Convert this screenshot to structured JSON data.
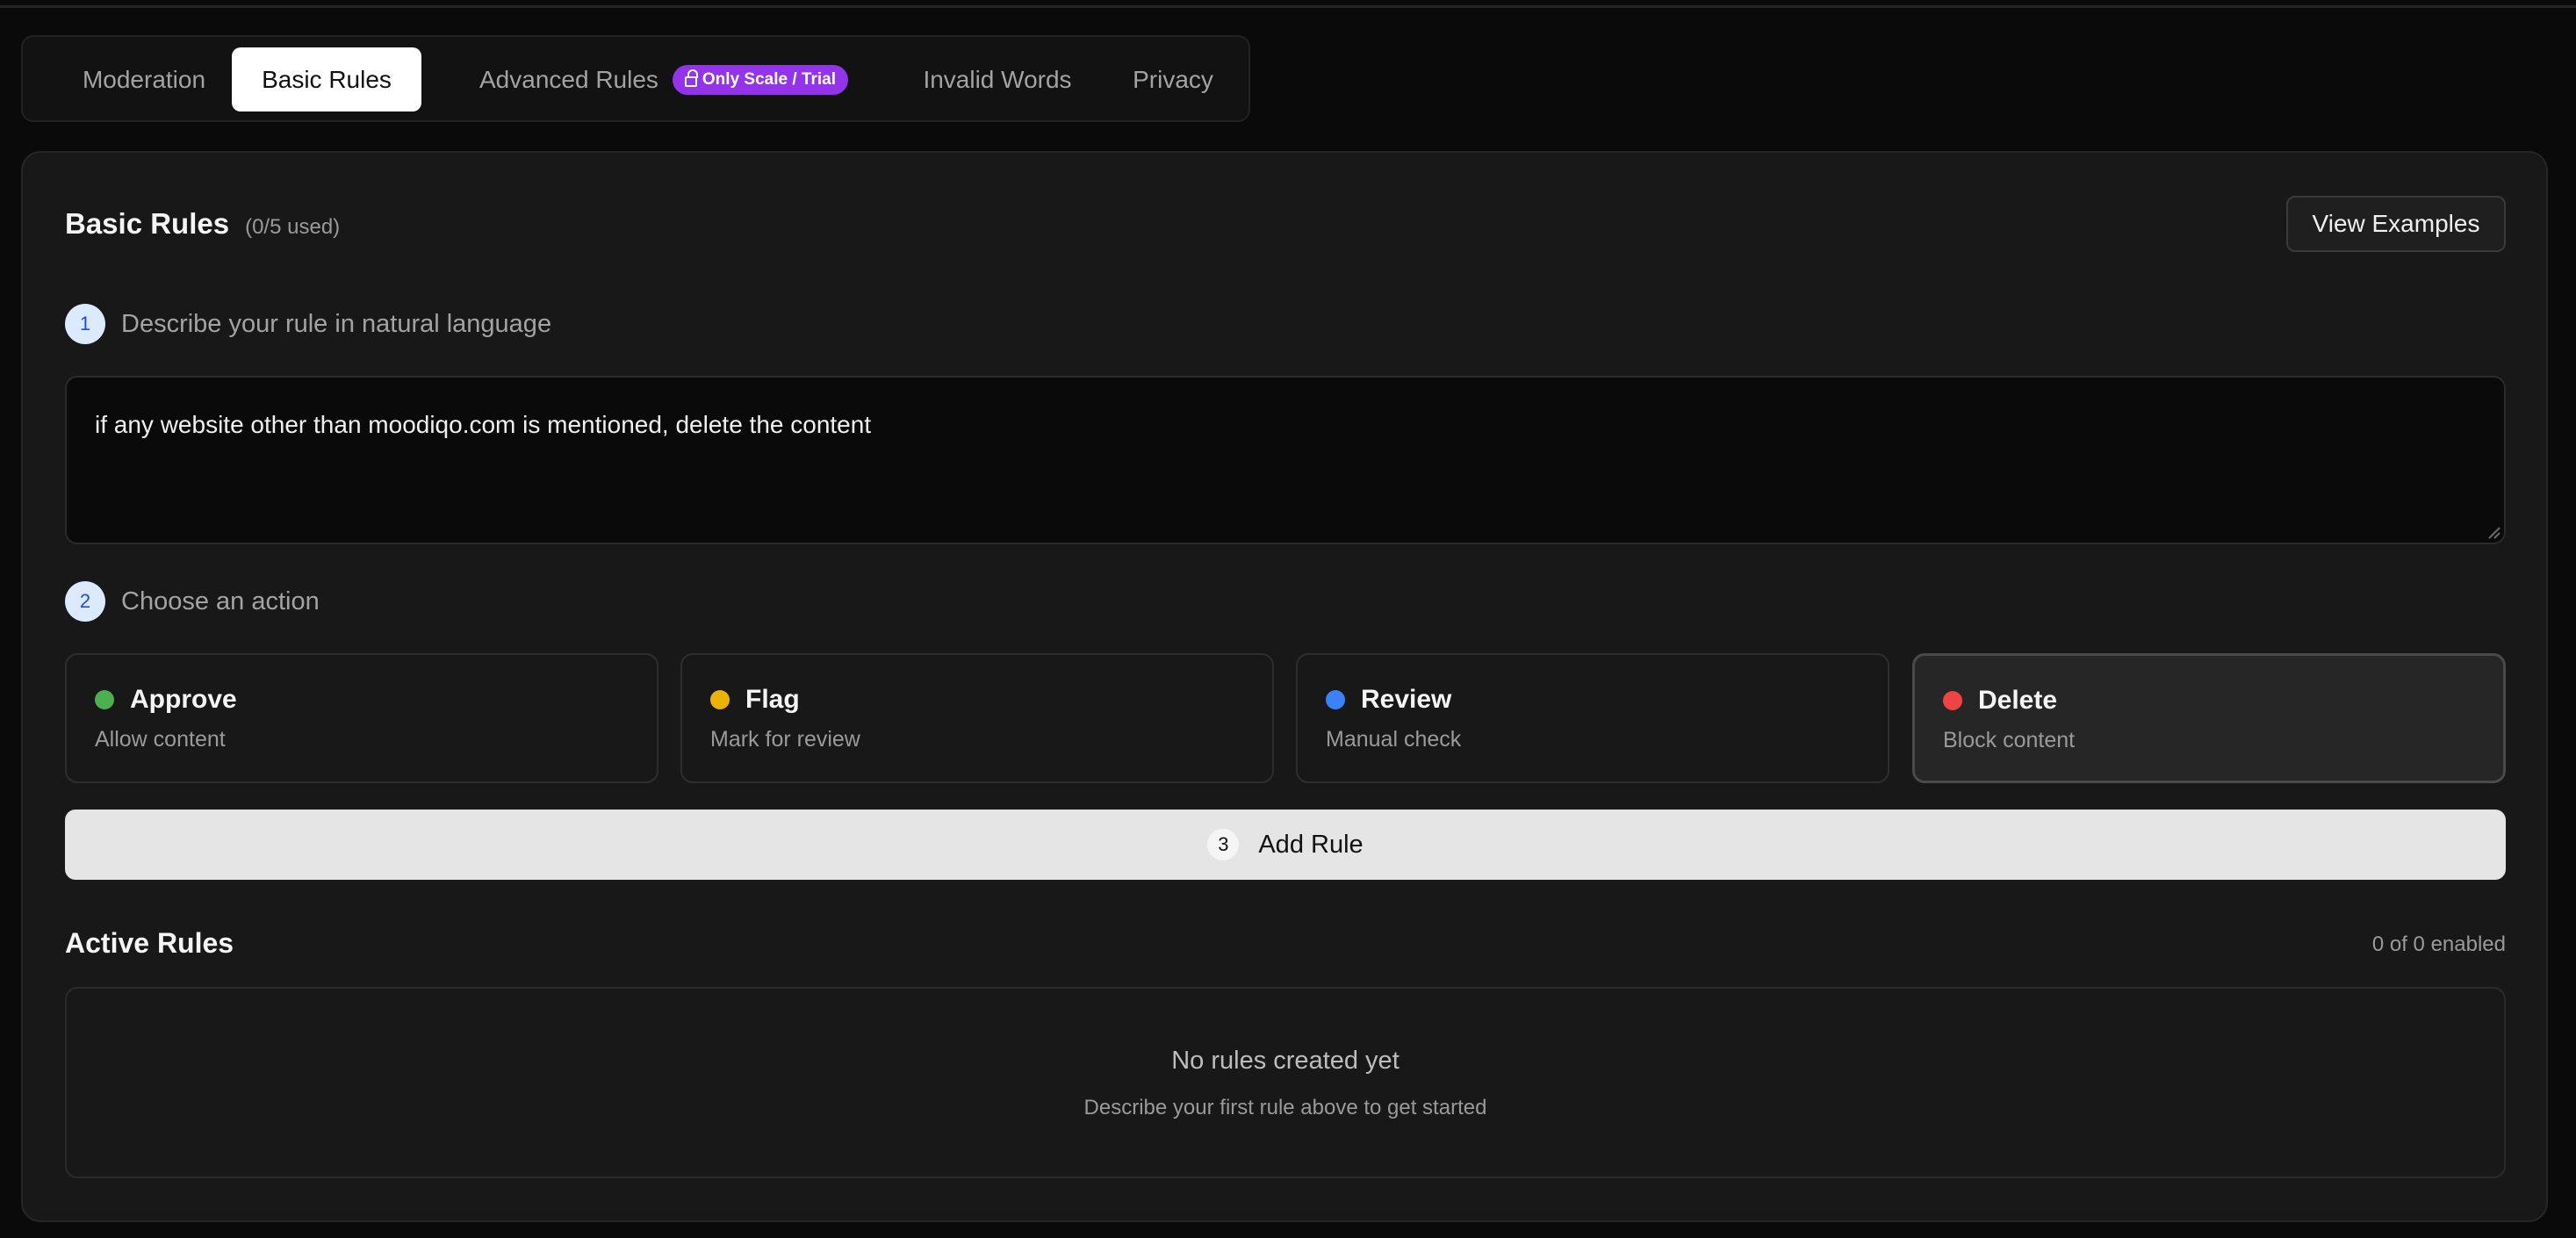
{
  "tabs": [
    {
      "label": "Moderation"
    },
    {
      "label": "Basic Rules"
    },
    {
      "label": "Advanced Rules",
      "badge": "Only Scale / Trial"
    },
    {
      "label": "Invalid Words"
    },
    {
      "label": "Privacy"
    }
  ],
  "active_tab": "Basic Rules",
  "panel": {
    "title": "Basic Rules",
    "used": "(0/5 used)",
    "view_examples": "View Examples"
  },
  "step1": {
    "num": "1",
    "label": "Describe your rule in natural language"
  },
  "rule_input": {
    "value": "if any website other than moodiqo.com is mentioned, delete the content"
  },
  "step2": {
    "num": "2",
    "label": "Choose an action"
  },
  "actions": [
    {
      "name": "Approve",
      "desc": "Allow content",
      "color": "#4caf50"
    },
    {
      "name": "Flag",
      "desc": "Mark for review",
      "color": "#eab308"
    },
    {
      "name": "Review",
      "desc": "Manual check",
      "color": "#3b82f6"
    },
    {
      "name": "Delete",
      "desc": "Block content",
      "color": "#ef4444"
    }
  ],
  "selected_action": "Delete",
  "add_rule": {
    "num": "3",
    "label": "Add Rule"
  },
  "active_rules": {
    "title": "Active Rules",
    "enabled": "0 of 0 enabled",
    "empty_title": "No rules created yet",
    "empty_subtitle": "Describe your first rule above to get started"
  }
}
